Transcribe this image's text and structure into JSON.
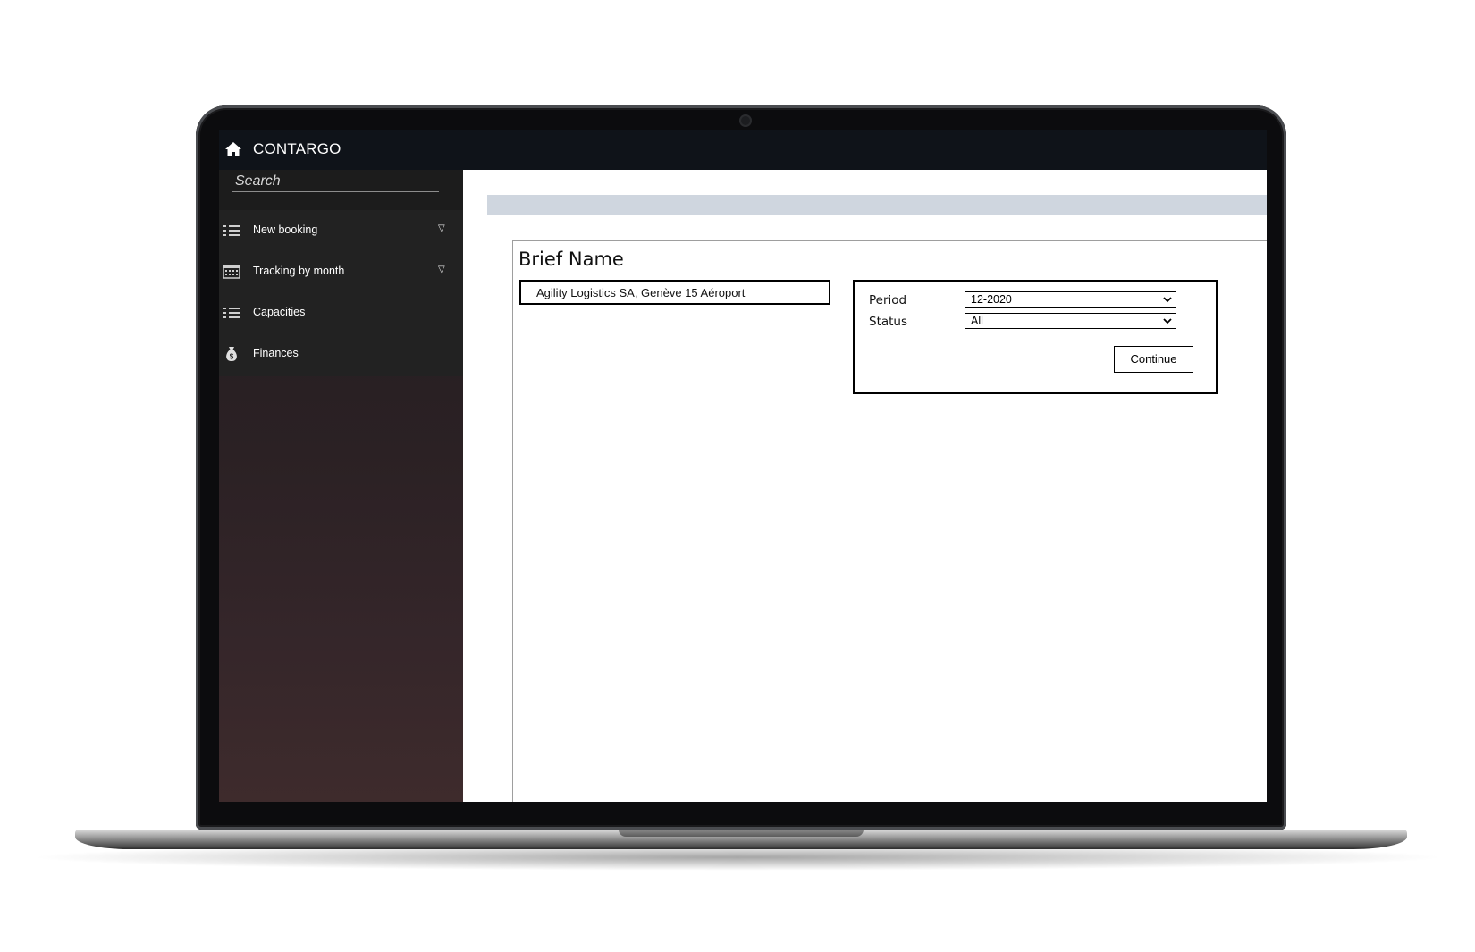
{
  "header": {
    "title": "CONTARGO"
  },
  "search": {
    "placeholder": "Search"
  },
  "sidebar": {
    "items": [
      {
        "label": "New booking",
        "icon": "list-icon",
        "has_caret": true
      },
      {
        "label": "Tracking by month",
        "icon": "calendar-icon",
        "has_caret": true
      },
      {
        "label": "Capacities",
        "icon": "list-icon",
        "has_caret": false
      },
      {
        "label": "Finances",
        "icon": "money-bag-icon",
        "has_caret": false
      }
    ],
    "caret_glyph": "▽"
  },
  "main": {
    "title": "Brief Name",
    "brief_value": "Agility Logistics SA, Genève 15 Aéroport",
    "filters": {
      "period_label": "Period",
      "period_value": "12-2020",
      "status_label": "Status",
      "status_value": "All",
      "continue_label": "Continue"
    }
  },
  "colors": {
    "topbar": "#0f1319",
    "sidebar_menu": "#222222",
    "gray_bar": "#cfd6df"
  }
}
